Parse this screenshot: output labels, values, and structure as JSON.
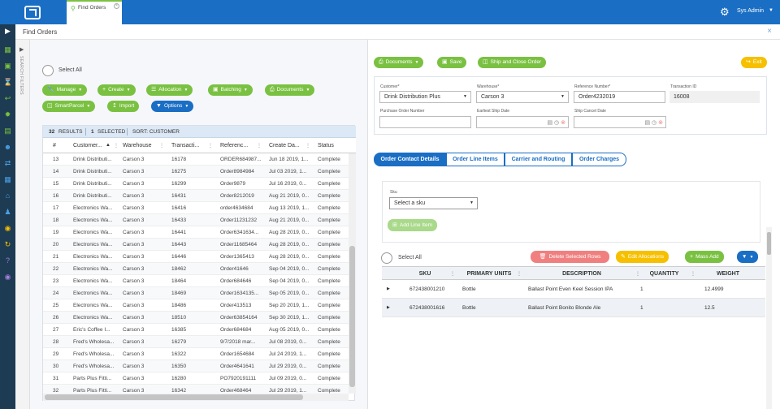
{
  "topbar": {
    "tab_label": "Find Orders",
    "user_name": "Sys Admin"
  },
  "header": {
    "title": "Find Orders",
    "close": "×"
  },
  "search_filters_label": "SEARCH FILTERS",
  "left": {
    "select_all": "Select All",
    "buttons": [
      {
        "label": "Manage"
      },
      {
        "label": "Create"
      },
      {
        "label": "Allocation"
      },
      {
        "label": "Batching"
      },
      {
        "label": "Documents"
      },
      {
        "label": "SmartParcel"
      },
      {
        "label": "Import"
      },
      {
        "label": "Options"
      }
    ]
  },
  "grid": {
    "info": {
      "results_count": "32",
      "results_label": "RESULTS",
      "selected_count": "1",
      "selected_label": "SELECTED",
      "sort_label": "SORT: CUSTOMER"
    },
    "columns": [
      "#",
      "Customer...",
      "Warehouse",
      "Transacti...",
      "Referenc...",
      "Create Da...",
      "Status"
    ],
    "rows": [
      [
        "13",
        "Drink Distributi...",
        "Carson 3",
        "16178",
        "ORDER684987...",
        "Jun 18 2019, 1...",
        "Complete"
      ],
      [
        "14",
        "Drink Distributi...",
        "Carson 3",
        "16275",
        "Order8984984",
        "Jul 03 2019, 1...",
        "Complete"
      ],
      [
        "15",
        "Drink Distributi...",
        "Carson 3",
        "16299",
        "Order9879",
        "Jul 16 2019, 0...",
        "Complete"
      ],
      [
        "16",
        "Drink Distributi...",
        "Carson 3",
        "16431",
        "Order8212019",
        "Aug 21 2019, 0...",
        "Complete"
      ],
      [
        "17",
        "Electronics Wa...",
        "Carson 3",
        "16416",
        "order4634684",
        "Aug 13 2019, 1...",
        "Complete"
      ],
      [
        "18",
        "Electronics Wa...",
        "Carson 3",
        "16433",
        "Order11231232",
        "Aug 21 2019, 0...",
        "Complete"
      ],
      [
        "19",
        "Electronics Wa...",
        "Carson 3",
        "16441",
        "Order6341634...",
        "Aug 28 2019, 0...",
        "Complete"
      ],
      [
        "20",
        "Electronics Wa...",
        "Carson 3",
        "16443",
        "Order11685464",
        "Aug 28 2019, 0...",
        "Complete"
      ],
      [
        "21",
        "Electronics Wa...",
        "Carson 3",
        "16446",
        "Order1365413",
        "Aug 28 2019, 0...",
        "Complete"
      ],
      [
        "22",
        "Electronics Wa...",
        "Carson 3",
        "18462",
        "Order41646",
        "Sep 04 2019, 0...",
        "Complete"
      ],
      [
        "23",
        "Electronics Wa...",
        "Carson 3",
        "18464",
        "Order684646",
        "Sep 04 2019, 0...",
        "Complete"
      ],
      [
        "24",
        "Electronics Wa...",
        "Carson 3",
        "18469",
        "Order1634135...",
        "Sep 05 2019, 0...",
        "Complete"
      ],
      [
        "25",
        "Electronics Wa...",
        "Carson 3",
        "18486",
        "Order413513",
        "Sep 20 2019, 1...",
        "Complete"
      ],
      [
        "26",
        "Electronics Wa...",
        "Carson 3",
        "18510",
        "Order63854164",
        "Sep 30 2019, 1...",
        "Complete"
      ],
      [
        "27",
        "Eric's Coffee I...",
        "Carson 3",
        "16385",
        "Order684684",
        "Aug 05 2019, 0...",
        "Complete"
      ],
      [
        "28",
        "Fred's Wholesa...",
        "Carson 3",
        "16279",
        "9/7/2018 mar...",
        "Jul 08 2019, 0...",
        "Complete"
      ],
      [
        "29",
        "Fred's Wholesa...",
        "Carson 3",
        "16322",
        "Order1654684",
        "Jul 24 2019, 1...",
        "Complete"
      ],
      [
        "30",
        "Fred's Wholesa...",
        "Carson 3",
        "16350",
        "Order4641641",
        "Jul 29 2019, 0...",
        "Complete"
      ],
      [
        "31",
        "Parts Plus Fitti...",
        "Carson 3",
        "16280",
        "PO7920191111",
        "Jul 09 2019, 0...",
        "Complete"
      ],
      [
        "32",
        "Parts Plus Fitti...",
        "Carson 3",
        "16342",
        "Order468464",
        "Jul 29 2019, 1...",
        "Complete"
      ]
    ]
  },
  "right": {
    "documents_btn": "Documents",
    "save_btn": "Save",
    "ship_close_btn": "Ship and Close Order",
    "exit_btn": "Exit",
    "form": {
      "customer_label": "Customer*",
      "customer_value": "Drink Distribution Plus",
      "warehouse_label": "Warehouse*",
      "warehouse_value": "Carson 3",
      "reference_label": "Reference Number*",
      "reference_value": "Order4232019",
      "transaction_label": "Transaction ID",
      "transaction_value": "16008",
      "po_label": "Purchase Order Number",
      "po_value": "",
      "earliest_label": "Earliest Ship Date",
      "cancel_label": "Ship Cancel Date"
    },
    "tabs": [
      "Order Contact Details",
      "Order Line Items",
      "Carrier and Routing",
      "Order Charges"
    ],
    "sku_label": "Sku",
    "sku_select": "Select a sku",
    "add_line_btn": "Add Line Item",
    "lines_select_all": "Select All",
    "delete_rows_btn": "Delete Selected Rows",
    "edit_alloc_btn": "Edit Allocations",
    "mass_add_btn": "Mass Add",
    "lines_columns": [
      "SKU",
      "PRIMARY UNITS",
      "DESCRIPTION",
      "QUANTITY",
      "WEIGHT"
    ],
    "lines": [
      [
        "672438001210",
        "Bottle",
        "Ballast Point Even Keel Session IPA",
        "1",
        "12.4999"
      ],
      [
        "672438001616",
        "Bottle",
        "Ballast Point Bonito Blonde Ale",
        "1",
        "12.5"
      ]
    ]
  },
  "colors": {
    "primary": "#1a6ec4",
    "success": "#7ac142",
    "warning": "#f6c000",
    "danger": "#f08080",
    "nav": "#1d3b52"
  }
}
